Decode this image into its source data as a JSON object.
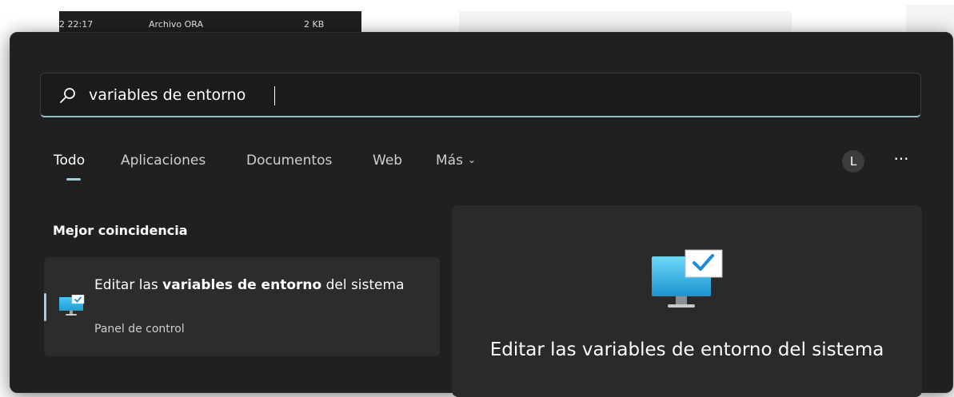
{
  "background": {
    "row": {
      "time": "2 22:17",
      "type": "Archivo ORA",
      "size": "2 KB"
    }
  },
  "search": {
    "value": "variables de entorno",
    "icon": "search-icon"
  },
  "tabs": [
    {
      "label": "Todo",
      "active": true
    },
    {
      "label": "Aplicaciones",
      "active": false
    },
    {
      "label": "Documentos",
      "active": false
    },
    {
      "label": "Web",
      "active": false
    },
    {
      "label": "Más",
      "active": false,
      "icon": "chevron-down-icon"
    }
  ],
  "account": {
    "initial": "L"
  },
  "more_label": "···",
  "best_match": {
    "heading": "Mejor coincidencia",
    "result": {
      "title_prefix": "Editar las ",
      "title_highlight": "variables de entorno",
      "title_suffix": " del sistema",
      "subtitle": "Panel de control",
      "icon": "system-settings-monitor-icon"
    }
  },
  "preview": {
    "title": "Editar las variables de entorno del sistema",
    "icon": "system-settings-monitor-icon"
  },
  "colors": {
    "accent": "#9fd0da",
    "panel": "#202020",
    "card": "#2c2c2c",
    "monitor_blue": "#29b6e8"
  }
}
